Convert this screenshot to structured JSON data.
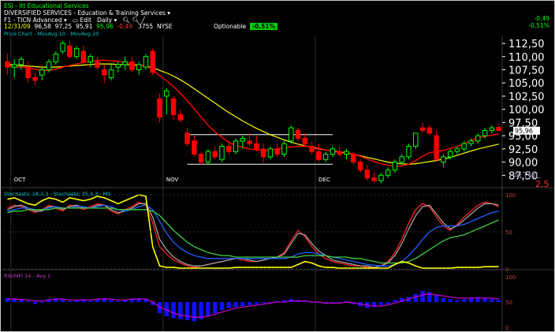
{
  "header": {
    "symbol_title": "ESI - Itt Educational Services",
    "sector": "DIVERSIFIED SERVICES - Education & Training Services",
    "toolbar": {
      "plan": "F1 - TICN Advanced",
      "edit": "Edit",
      "period": "Daily"
    },
    "quote": {
      "date": "12/31/09",
      "open": "96,58",
      "high": "97,25",
      "low": "95,91",
      "close": "95,96",
      "change": "-0,49",
      "volume": "3755",
      "exchange": "NYSE"
    },
    "optionable_label": "Optionable",
    "optionable_value": "-0,51%",
    "net_change": "-0,49",
    "net_change_pct": "-0,51%"
  },
  "colors": {
    "up": "#00ff00",
    "down": "#ff0000",
    "ma_short": "#ff0000",
    "ma_long": "#ffff00",
    "grid": "#1e1e1e",
    "axis_text": "#ffffff",
    "osc_blue": "#1010ff",
    "osc_magenta": "#c000c0"
  },
  "chart_data": [
    {
      "type": "candlestick",
      "legend": "Price Chart - MovAvg 10 - MovAvg 20",
      "x_labels": [
        "OCT",
        "NOV",
        "DEC"
      ],
      "y_ticks": [
        "112,50",
        "110,00",
        "107,50",
        "105,00",
        "102,50",
        "100,00",
        "97,50",
        "95,00",
        "92,50",
        "90,00",
        "87,50"
      ],
      "ylim": [
        86.5,
        114.0
      ],
      "last_price_label": "95,96",
      "watermark": "ALTML",
      "extra_value": "2,5",
      "candles": [
        [
          109.0,
          110.5,
          106.5,
          108.0
        ],
        [
          108.0,
          109.5,
          106.0,
          108.5
        ],
        [
          108.5,
          110.0,
          107.5,
          109.5
        ],
        [
          108.0,
          109.0,
          105.0,
          106.0
        ],
        [
          106.0,
          107.0,
          104.5,
          105.5
        ],
        [
          106.5,
          108.0,
          105.5,
          107.5
        ],
        [
          107.5,
          109.5,
          107.0,
          109.0
        ],
        [
          109.0,
          111.0,
          108.5,
          110.5
        ],
        [
          111.0,
          113.0,
          110.5,
          112.5
        ],
        [
          112.0,
          113.0,
          109.5,
          110.0
        ],
        [
          110.0,
          112.0,
          109.5,
          111.5
        ],
        [
          111.0,
          112.0,
          108.5,
          109.0
        ],
        [
          109.0,
          110.5,
          108.0,
          110.0
        ],
        [
          109.0,
          110.0,
          107.5,
          108.0
        ],
        [
          107.5,
          108.5,
          105.0,
          106.5
        ],
        [
          106.0,
          108.5,
          105.5,
          107.5
        ],
        [
          108.0,
          109.0,
          107.0,
          108.5
        ],
        [
          108.5,
          110.0,
          107.5,
          109.0
        ],
        [
          109.0,
          110.0,
          107.0,
          107.5
        ],
        [
          107.5,
          109.0,
          106.5,
          108.5
        ],
        [
          108.0,
          110.5,
          107.5,
          110.0
        ],
        [
          111.0,
          111.5,
          106.5,
          107.0
        ],
        [
          102.0,
          103.0,
          97.5,
          98.5
        ],
        [
          102.5,
          104.0,
          99.0,
          103.5
        ],
        [
          102.0,
          102.5,
          98.0,
          99.0
        ],
        [
          99.0,
          100.0,
          97.5,
          98.0
        ],
        [
          95.5,
          96.5,
          93.0,
          93.5
        ],
        [
          94.0,
          95.0,
          91.0,
          91.5
        ],
        [
          91.5,
          92.0,
          89.5,
          90.0
        ],
        [
          90.0,
          92.5,
          89.5,
          92.0
        ],
        [
          92.0,
          93.0,
          90.5,
          91.0
        ],
        [
          90.5,
          93.5,
          90.0,
          93.0
        ],
        [
          93.0,
          94.0,
          91.5,
          92.0
        ],
        [
          92.0,
          94.5,
          91.5,
          94.0
        ],
        [
          94.0,
          95.0,
          92.5,
          94.5
        ],
        [
          94.0,
          95.5,
          93.0,
          93.5
        ],
        [
          93.5,
          95.0,
          92.0,
          92.5
        ],
        [
          92.5,
          93.5,
          90.0,
          91.0
        ],
        [
          91.0,
          93.0,
          90.5,
          92.5
        ],
        [
          92.5,
          93.5,
          91.0,
          91.5
        ],
        [
          91.5,
          94.0,
          91.0,
          93.5
        ],
        [
          94.0,
          97.0,
          93.5,
          96.5
        ],
        [
          96.0,
          96.5,
          94.0,
          94.5
        ],
        [
          94.5,
          95.5,
          93.0,
          93.5
        ],
        [
          93.0,
          94.0,
          91.5,
          92.0
        ],
        [
          92.0,
          93.5,
          90.0,
          90.5
        ],
        [
          90.5,
          92.0,
          90.0,
          91.5
        ],
        [
          91.5,
          93.0,
          91.0,
          92.5
        ],
        [
          92.0,
          93.0,
          91.0,
          91.5
        ],
        [
          91.5,
          92.5,
          90.5,
          92.0
        ],
        [
          91.5,
          92.0,
          89.5,
          90.0
        ],
        [
          90.0,
          90.5,
          88.0,
          88.5
        ],
        [
          88.5,
          89.5,
          86.5,
          87.0
        ],
        [
          87.0,
          88.0,
          86.0,
          86.5
        ],
        [
          86.5,
          88.0,
          86.0,
          87.5
        ],
        [
          87.5,
          89.0,
          87.0,
          88.5
        ],
        [
          88.5,
          90.5,
          88.0,
          90.0
        ],
        [
          90.0,
          91.5,
          89.5,
          91.0
        ],
        [
          91.0,
          93.5,
          90.5,
          93.0
        ],
        [
          93.0,
          95.5,
          92.5,
          95.5
        ],
        [
          96.5,
          97.5,
          95.5,
          96.0
        ],
        [
          96.5,
          97.0,
          95.0,
          95.5
        ],
        [
          95.0,
          96.0,
          90.0,
          90.5
        ],
        [
          90.0,
          91.5,
          89.0,
          91.0
        ],
        [
          91.0,
          92.5,
          90.5,
          92.0
        ],
        [
          92.0,
          93.0,
          91.5,
          92.5
        ],
        [
          92.5,
          94.0,
          92.0,
          93.5
        ],
        [
          93.5,
          94.5,
          93.0,
          94.0
        ],
        [
          94.0,
          95.5,
          93.5,
          95.0
        ],
        [
          95.0,
          96.5,
          94.5,
          96.0
        ],
        [
          96.0,
          97.0,
          95.5,
          96.5
        ],
        [
          96.58,
          97.25,
          95.91,
          95.96
        ]
      ],
      "ma10": [
        108.2,
        108.0,
        108.0,
        107.9,
        107.6,
        107.4,
        107.4,
        107.6,
        108.0,
        108.3,
        108.6,
        108.9,
        109.1,
        109.3,
        109.3,
        109.2,
        109.1,
        108.9,
        108.6,
        108.4,
        108.2,
        107.6,
        106.4,
        105.4,
        104.3,
        103.1,
        101.6,
        100.1,
        98.5,
        97.0,
        95.7,
        94.7,
        93.7,
        93.2,
        92.8,
        92.5,
        92.3,
        92.2,
        92.3,
        92.5,
        92.7,
        92.9,
        93.0,
        93.0,
        92.9,
        92.6,
        92.3,
        92.2,
        92.0,
        91.8,
        91.5,
        91.1,
        90.6,
        90.1,
        89.7,
        89.4,
        89.2,
        89.3,
        89.6,
        90.3,
        91.1,
        91.8,
        92.0,
        92.2,
        92.6,
        93.0,
        93.5,
        94.1,
        94.6,
        94.9,
        95.1,
        95.3
      ],
      "ma20": [
        108.5,
        108.4,
        108.3,
        108.2,
        108.1,
        108.0,
        108.0,
        108.0,
        108.1,
        108.2,
        108.3,
        108.4,
        108.5,
        108.6,
        108.6,
        108.6,
        108.5,
        108.5,
        108.4,
        108.3,
        108.2,
        107.9,
        107.4,
        106.9,
        106.3,
        105.6,
        104.8,
        103.9,
        103.0,
        102.1,
        101.2,
        100.3,
        99.4,
        98.6,
        97.8,
        97.1,
        96.4,
        95.8,
        95.2,
        94.7,
        94.2,
        93.8,
        93.4,
        93.1,
        92.8,
        92.5,
        92.3,
        92.1,
        91.9,
        91.7,
        91.5,
        91.2,
        90.9,
        90.6,
        90.3,
        90.0,
        89.8,
        89.7,
        89.6,
        89.7,
        89.9,
        90.1,
        90.3,
        90.6,
        90.9,
        91.3,
        91.7,
        92.1,
        92.5,
        92.8,
        93.1,
        93.4
      ]
    },
    {
      "type": "line",
      "legend": "Stochastic 18,3,3 - Stochastic 35,3,3 - MS",
      "y_ticks": [
        "100",
        "50",
        "0"
      ],
      "ylim": [
        0,
        100
      ],
      "series": [
        {
          "values": [
            82,
            86,
            84,
            80,
            76,
            80,
            86,
            82,
            78,
            86,
            84,
            80,
            84,
            88,
            86,
            78,
            74,
            80,
            84,
            90,
            86,
            62,
            30,
            20,
            12,
            8,
            4,
            2,
            4,
            6,
            8,
            10,
            12,
            14,
            12,
            10,
            10,
            12,
            14,
            16,
            22,
            38,
            52,
            44,
            30,
            20,
            14,
            10,
            8,
            6,
            4,
            4,
            2,
            2,
            4,
            10,
            22,
            40,
            62,
            80,
            88,
            84,
            70,
            58,
            52,
            60,
            70,
            78,
            86,
            90,
            88,
            84
          ]
        },
        {
          "values": [
            80,
            84,
            86,
            82,
            78,
            78,
            84,
            84,
            80,
            84,
            86,
            82,
            82,
            86,
            86,
            80,
            76,
            78,
            82,
            88,
            88,
            70,
            40,
            26,
            16,
            10,
            6,
            4,
            4,
            6,
            8,
            10,
            12,
            14,
            14,
            12,
            10,
            12,
            14,
            16,
            20,
            34,
            48,
            46,
            34,
            24,
            18,
            12,
            10,
            8,
            6,
            4,
            4,
            2,
            4,
            8,
            18,
            34,
            54,
            72,
            84,
            86,
            74,
            62,
            54,
            58,
            66,
            74,
            82,
            88,
            88,
            86
          ]
        },
        {
          "values": [
            78,
            80,
            82,
            82,
            80,
            80,
            82,
            84,
            82,
            82,
            84,
            84,
            82,
            84,
            86,
            84,
            80,
            78,
            80,
            84,
            86,
            80,
            64,
            48,
            36,
            28,
            22,
            18,
            16,
            14,
            14,
            14,
            14,
            14,
            14,
            14,
            14,
            14,
            14,
            14,
            14,
            16,
            20,
            22,
            22,
            20,
            18,
            16,
            14,
            12,
            10,
            8,
            6,
            5,
            4,
            4,
            6,
            10,
            18,
            28,
            40,
            50,
            56,
            58,
            58,
            58,
            60,
            64,
            68,
            72,
            76,
            78
          ]
        },
        {
          "values": [
            76,
            78,
            78,
            80,
            80,
            80,
            80,
            82,
            82,
            82,
            82,
            82,
            82,
            82,
            82,
            82,
            80,
            80,
            80,
            80,
            80,
            78,
            72,
            62,
            52,
            44,
            36,
            30,
            26,
            22,
            20,
            18,
            18,
            16,
            16,
            16,
            16,
            16,
            16,
            16,
            16,
            16,
            16,
            18,
            18,
            18,
            18,
            16,
            16,
            16,
            14,
            14,
            12,
            10,
            8,
            8,
            8,
            8,
            10,
            14,
            20,
            26,
            32,
            38,
            42,
            44,
            46,
            50,
            54,
            58,
            62,
            66
          ]
        },
        {
          "values": [
            94,
            96,
            92,
            88,
            86,
            92,
            96,
            94,
            90,
            96,
            94,
            92,
            94,
            98,
            96,
            92,
            88,
            92,
            96,
            100,
            98,
            30,
            4,
            2,
            2,
            1,
            1,
            1,
            1,
            1,
            1,
            1,
            1,
            2,
            2,
            2,
            2,
            2,
            2,
            2,
            2,
            2,
            6,
            10,
            8,
            4,
            2,
            2,
            1,
            1,
            1,
            1,
            1,
            1,
            1,
            1,
            6,
            10,
            8,
            4,
            1,
            1,
            1,
            1,
            1,
            2,
            2,
            2,
            2,
            3,
            3,
            3
          ]
        }
      ]
    },
    {
      "type": "bar",
      "legend": "RSI/MFI 14 - Avg 1",
      "y_ticks": [
        "100",
        "50",
        "0"
      ],
      "ylim": [
        0,
        100
      ],
      "baseline": 50,
      "values": [
        58,
        56,
        54,
        52,
        46,
        50,
        56,
        58,
        56,
        52,
        54,
        56,
        52,
        56,
        58,
        54,
        52,
        54,
        56,
        58,
        56,
        44,
        28,
        22,
        18,
        16,
        14,
        12,
        16,
        22,
        28,
        34,
        38,
        40,
        42,
        44,
        46,
        48,
        50,
        52,
        54,
        56,
        54,
        52,
        50,
        48,
        46,
        48,
        50,
        52,
        46,
        42,
        38,
        40,
        44,
        46,
        54,
        58,
        60,
        66,
        72,
        70,
        64,
        58,
        56,
        54,
        56,
        58,
        60,
        58,
        56,
        54
      ],
      "line": [
        56,
        56,
        55,
        54,
        52,
        52,
        54,
        56,
        56,
        54,
        54,
        54,
        54,
        56,
        56,
        56,
        54,
        54,
        56,
        56,
        56,
        50,
        40,
        34,
        28,
        24,
        22,
        20,
        20,
        22,
        26,
        30,
        34,
        38,
        40,
        42,
        44,
        46,
        48,
        50,
        50,
        52,
        52,
        52,
        50,
        50,
        48,
        48,
        48,
        50,
        48,
        46,
        44,
        42,
        42,
        44,
        48,
        52,
        56,
        60,
        64,
        66,
        64,
        62,
        60,
        58,
        58,
        58,
        58,
        58,
        58,
        56
      ]
    }
  ]
}
